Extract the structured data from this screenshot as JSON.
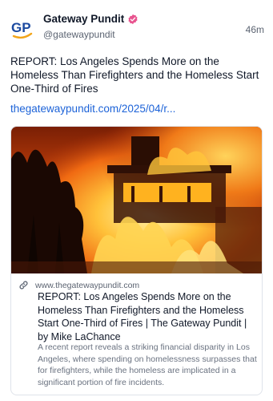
{
  "author": {
    "name": "Gateway Pundit",
    "handle": "@gatewaypundit",
    "avatar_text": "GP",
    "verified_icon": "verified-badge",
    "verified_color": "#e8548f",
    "brand_color": "#1b4aa0",
    "accent_color": "#f2a51a"
  },
  "post": {
    "time": "46m",
    "text": "REPORT: Los Angeles Spends More on the Homeless Than Firefighters and the Homeless Start One-Third of Fires",
    "link_text": "thegatewaypundit.com/2025/04/r...",
    "link_color": "#1d63d8"
  },
  "card": {
    "image_description_icon": "fire-photo",
    "domain": "www.thegatewaypundit.com",
    "title": "REPORT: Los Angeles Spends More on the Homeless Than Firefighters and the Homeless Start One-Third of Fires | The Gateway Pundit | by Mike LaChance",
    "description": "A recent report reveals a striking financial disparity in Los Angeles, where spending on homelessness surpasses that for firefighters, while the homeless are implicated in a significant portion of fire incidents.",
    "link_icon": "link-icon"
  }
}
